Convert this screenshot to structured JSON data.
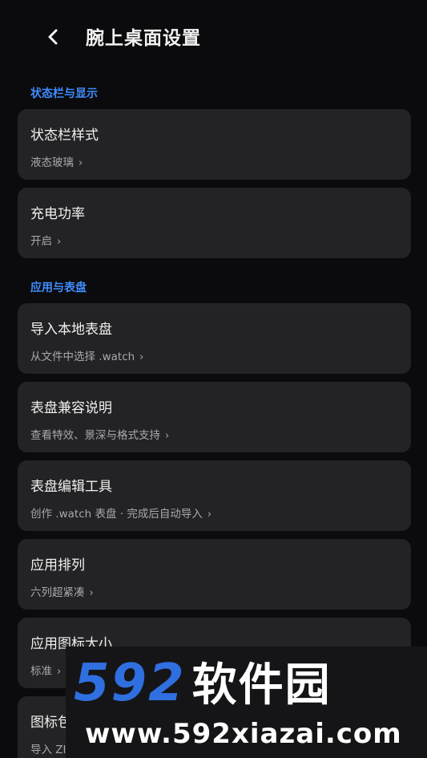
{
  "header": {
    "title": "腕上桌面设置"
  },
  "sections": {
    "status_bar": "状态栏与显示",
    "apps_faces": "应用与表盘"
  },
  "items": [
    {
      "title": "状态栏样式",
      "sub": "液态玻璃"
    },
    {
      "title": "充电功率",
      "sub": "开启"
    },
    {
      "title": "导入本地表盘",
      "sub": "从文件中选择 .watch"
    },
    {
      "title": "表盘兼容说明",
      "sub": "查看特效、景深与格式支持"
    },
    {
      "title": "表盘编辑工具",
      "sub": "创作 .watch 表盘 · 完成后自动导入"
    },
    {
      "title": "应用排列",
      "sub": "六列超紧凑"
    },
    {
      "title": "应用图标大小",
      "sub": "标准"
    },
    {
      "title": "图标包",
      "sub": "导入 ZI"
    }
  ],
  "chevron": "›",
  "watermark": {
    "number": "592",
    "name": "软件园",
    "url": "www.592xiazai.com"
  },
  "colors": {
    "background": "#0b0b0d",
    "card": "#232325",
    "accent": "#3f8cff"
  }
}
